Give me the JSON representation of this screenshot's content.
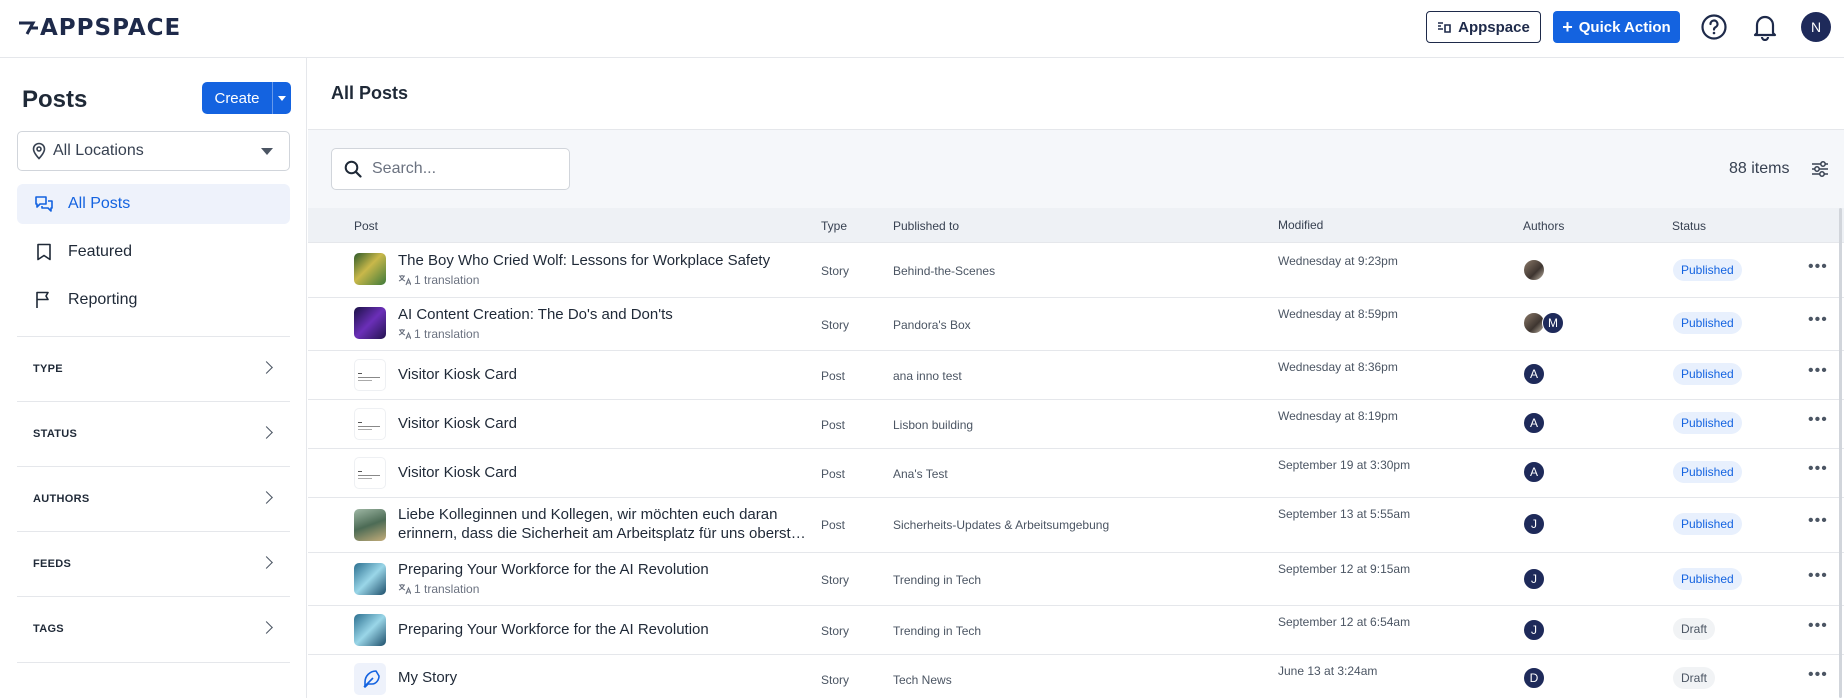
{
  "app": {
    "logo_text": "APPSPACE",
    "header_buttons": {
      "appspace": "Appspace",
      "quick_action": "Quick Action"
    },
    "user_initial": "N",
    "accent_color": "#1463e0"
  },
  "sidebar": {
    "title": "Posts",
    "create_label": "Create",
    "location_select": "All Locations",
    "nav": [
      {
        "label": "All Posts",
        "icon": "chat-bubbles-icon",
        "active": true
      },
      {
        "label": "Featured",
        "icon": "bookmark-icon",
        "active": false
      },
      {
        "label": "Reporting",
        "icon": "flag-icon",
        "active": false
      }
    ],
    "filters": [
      "TYPE",
      "STATUS",
      "AUTHORS",
      "FEEDS",
      "TAGS"
    ]
  },
  "main": {
    "title": "All Posts",
    "search_placeholder": "Search...",
    "item_count": "88 items",
    "columns": {
      "post": "Post",
      "type": "Type",
      "published_to": "Published to",
      "modified": "Modified",
      "authors": "Authors",
      "status": "Status"
    },
    "rows": [
      {
        "title": "The Boy Who Cried Wolf: Lessons for Workplace Safety",
        "sub": "1 translation",
        "type": "Story",
        "published_to": "Behind-the-Scenes",
        "modified": "Wednesday at 9:23pm",
        "authors": [
          "photo"
        ],
        "status": "Published",
        "thumb": "forest"
      },
      {
        "title": "AI Content Creation: The Do's and Don'ts",
        "sub": "1 translation",
        "type": "Story",
        "published_to": "Pandora's Box",
        "modified": "Wednesday at 8:59pm",
        "authors": [
          "photo",
          "M"
        ],
        "status": "Published",
        "thumb": "purple"
      },
      {
        "title": "Visitor Kiosk Card",
        "sub": "",
        "type": "Post",
        "published_to": "ana inno test",
        "modified": "Wednesday at 8:36pm",
        "authors": [
          "A"
        ],
        "status": "Published",
        "thumb": "card"
      },
      {
        "title": "Visitor Kiosk Card",
        "sub": "",
        "type": "Post",
        "published_to": "Lisbon building",
        "modified": "Wednesday at 8:19pm",
        "authors": [
          "A"
        ],
        "status": "Published",
        "thumb": "card"
      },
      {
        "title": "Visitor Kiosk Card",
        "sub": "",
        "type": "Post",
        "published_to": "Ana's Test",
        "modified": "September 19 at 3:30pm",
        "authors": [
          "A"
        ],
        "status": "Published",
        "thumb": "card"
      },
      {
        "title": "Liebe Kolleginnen und Kollegen, wir möchten euch daran",
        "title2": "erinnern, dass die Sicherheit am Arbeitsplatz für uns oberst…",
        "sub": "",
        "type": "Post",
        "published_to": "Sicherheits-Updates & Arbeitsumgebung",
        "modified": "September 13 at 5:55am",
        "authors": [
          "J"
        ],
        "status": "Published",
        "thumb": "building"
      },
      {
        "title": "Preparing Your Workforce for the AI Revolution",
        "sub": "1 translation",
        "type": "Story",
        "published_to": "Trending in Tech",
        "modified": "September 12 at 9:15am",
        "authors": [
          "J"
        ],
        "status": "Published",
        "thumb": "tech"
      },
      {
        "title": "Preparing Your Workforce for the AI Revolution",
        "sub": "",
        "type": "Story",
        "published_to": "Trending in Tech",
        "modified": "September 12 at 6:54am",
        "authors": [
          "J"
        ],
        "status": "Draft",
        "thumb": "tech"
      },
      {
        "title": "My Story",
        "sub": "",
        "type": "Story",
        "published_to": "Tech News",
        "modified": "June 13 at 3:24am",
        "authors": [
          "D"
        ],
        "status": "Draft",
        "thumb": "feather"
      }
    ]
  }
}
